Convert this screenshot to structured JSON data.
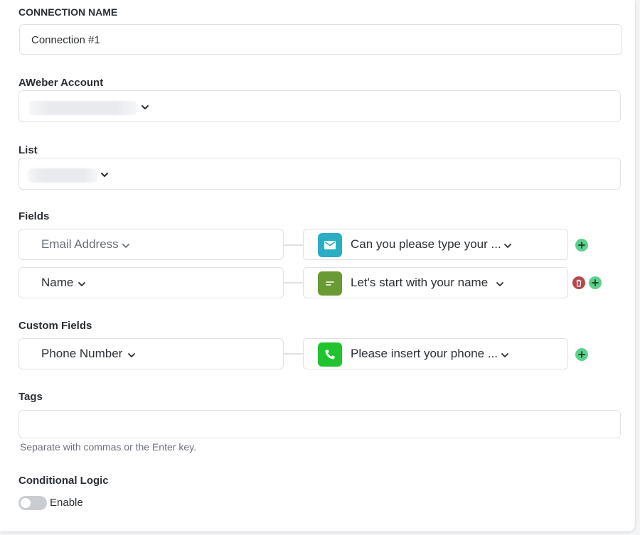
{
  "connection_name": {
    "label": "CONNECTION NAME",
    "value": "Connection #1"
  },
  "account": {
    "label": "AWeber Account"
  },
  "list": {
    "label": "List"
  },
  "fields": {
    "label": "Fields",
    "rows": [
      {
        "provider_field": "Email Address",
        "question": "Can you please type your ...",
        "icon": "email-icon",
        "icon_color": "#2aaec4",
        "muted": true
      },
      {
        "provider_field": "Name",
        "question": "Let's start with your name",
        "icon": "short-text-icon",
        "icon_color": "#6a9a34",
        "muted": false
      }
    ]
  },
  "custom_fields": {
    "label": "Custom Fields",
    "rows": [
      {
        "provider_field": "Phone Number",
        "question": "Please insert your phone ...",
        "icon": "phone-icon",
        "icon_color": "#1fc42f"
      }
    ]
  },
  "tags": {
    "label": "Tags",
    "hint": "Separate with commas or the Enter key."
  },
  "conditional_logic": {
    "label": "Conditional Logic",
    "toggle_label": "Enable"
  },
  "colors": {
    "add": "#5cd18d",
    "delete": "#b5484d"
  }
}
